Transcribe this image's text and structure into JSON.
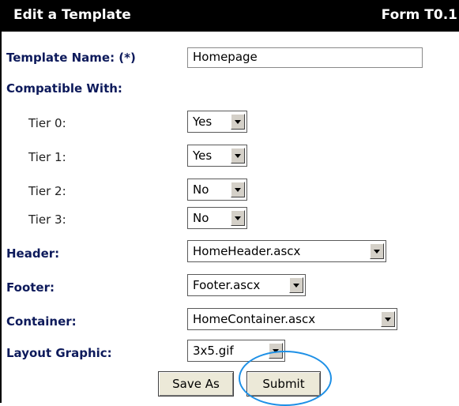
{
  "header": {
    "title": "Edit a Template",
    "form_id": "Form T0.1"
  },
  "fields": {
    "template_name": {
      "label": "Template Name: (*)",
      "value": "Homepage"
    },
    "compatible_with": {
      "label": "Compatible With:"
    },
    "tiers": [
      {
        "label": "Tier 0:",
        "value": "Yes"
      },
      {
        "label": "Tier 1:",
        "value": "Yes"
      },
      {
        "label": "Tier 2:",
        "value": "No"
      },
      {
        "label": "Tier 3:",
        "value": "No"
      }
    ],
    "header": {
      "label": "Header:",
      "value": "HomeHeader.ascx"
    },
    "footer": {
      "label": "Footer:",
      "value": "Footer.ascx"
    },
    "container": {
      "label": "Container:",
      "value": "HomeContainer.ascx"
    },
    "layout_graphic": {
      "label": "Layout Graphic:",
      "value": "3x5.gif"
    }
  },
  "buttons": {
    "save_as": "Save As",
    "submit": "Submit"
  },
  "annotation": {
    "highlight_color": "#1e90e6",
    "highlight_target": "submit"
  }
}
